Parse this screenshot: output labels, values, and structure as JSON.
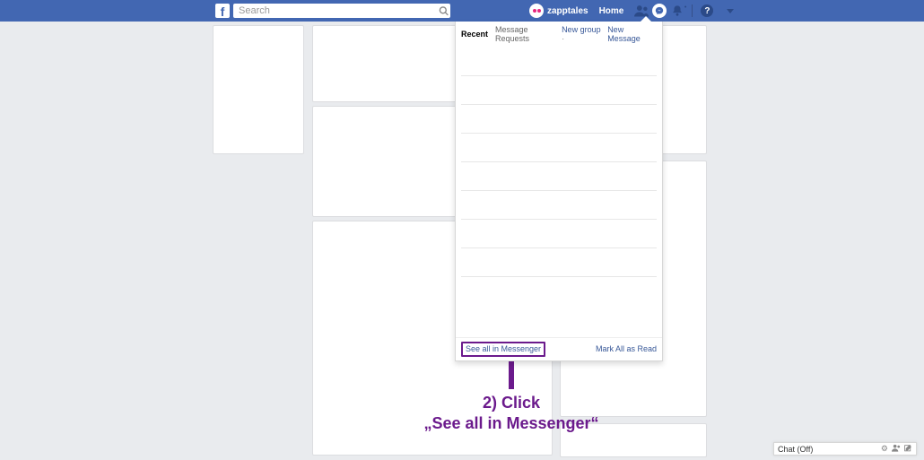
{
  "topbar": {
    "search_placeholder": "Search",
    "username": "zapptales",
    "home": "Home",
    "help_label": "?"
  },
  "dropdown": {
    "tabs": {
      "recent": "Recent",
      "requests": "Message Requests"
    },
    "links": {
      "new_group": "New group",
      "new_message": "New Message"
    },
    "footer": {
      "see_all": "See all in Messenger",
      "mark_read": "Mark All as Read"
    }
  },
  "annotation": {
    "line1": "2) Click",
    "line2": "„See all in Messenger“"
  },
  "chat_dock": {
    "label": "Chat (Off)"
  }
}
